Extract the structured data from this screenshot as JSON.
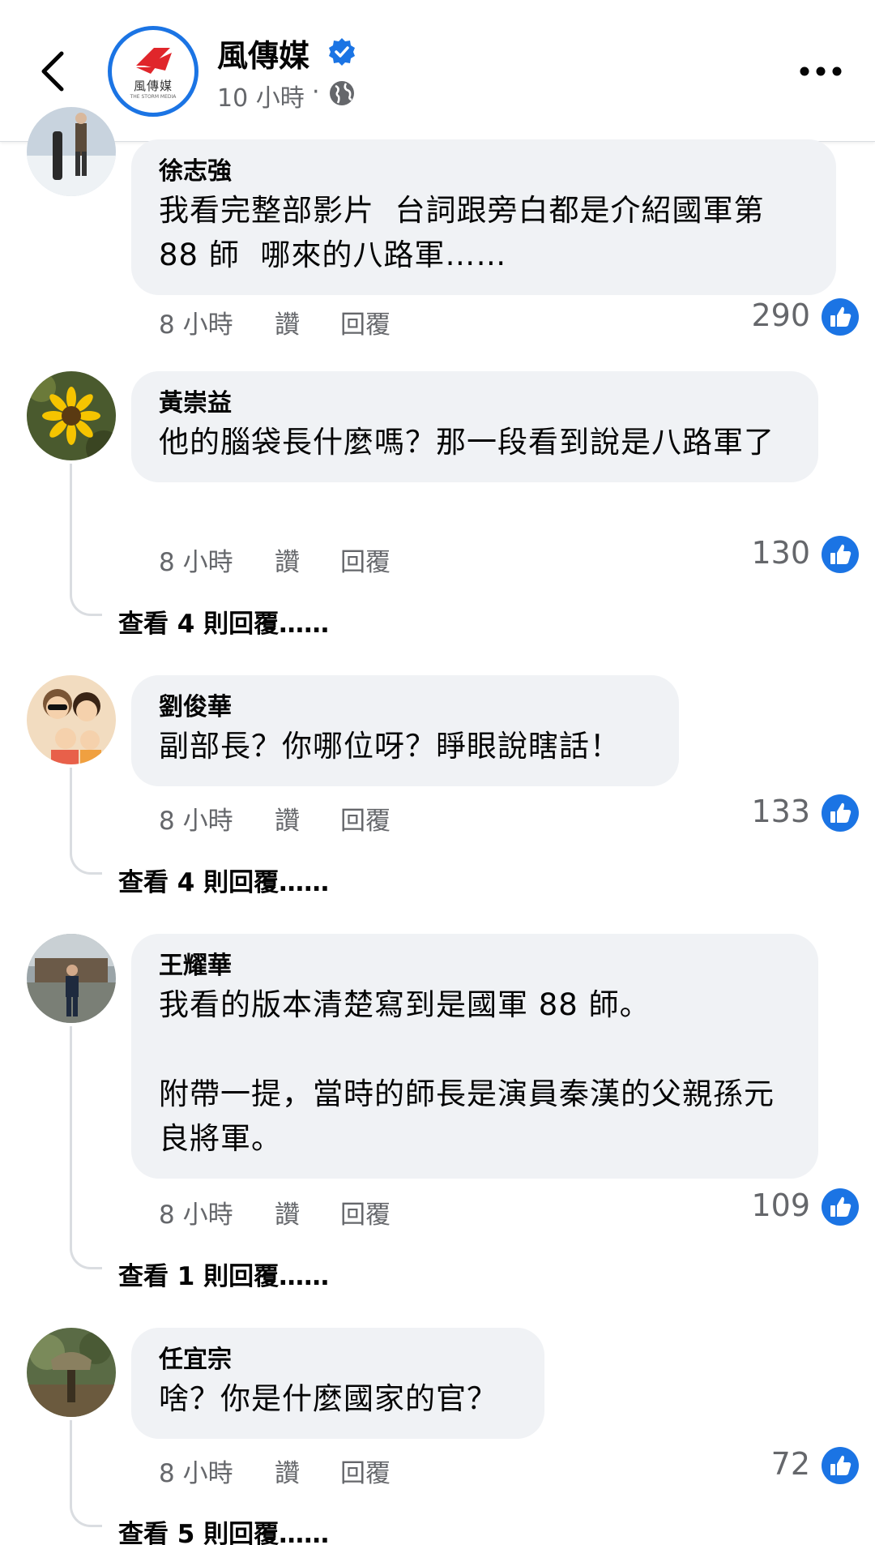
{
  "header": {
    "page_name": "風傳媒",
    "logo_text": "風傳媒",
    "logo_subtext": "THE STORM MEDIA",
    "post_time": "10 小時",
    "separator": "·",
    "icons": {
      "back": "chevron-left-icon",
      "verified": "verified-badge-icon",
      "audience": "globe-icon",
      "more": "more-icon"
    },
    "colors": {
      "accent": "#1b74e4",
      "logo_red": "#e0262b"
    }
  },
  "actions": {
    "like": "讚",
    "reply": "回覆"
  },
  "comments": [
    {
      "author": "徐志強",
      "text": "我看完整部影片  台詞跟旁白都是介紹國軍第 88 師  哪來的八路軍……",
      "time": "8 小時",
      "likes": "290",
      "view_replies": ""
    },
    {
      "author": "黃崇益",
      "text": "他的腦袋長什麼嗎？那一段看到說是八路軍了",
      "time": "8 小時",
      "likes": "130",
      "view_replies": "查看 4 則回覆……"
    },
    {
      "author": "劉俊華",
      "text": "副部長？你哪位呀？睜眼說瞎話！",
      "time": "8 小時",
      "likes": "133",
      "view_replies": "查看 4 則回覆……"
    },
    {
      "author": "王耀華",
      "text": "我看的版本清楚寫到是國軍 88 師。\n\n附帶一提，當時的師長是演員秦漢的父親孫元良將軍。",
      "time": "8 小時",
      "likes": "109",
      "view_replies": "查看 1 則回覆……"
    },
    {
      "author": "任宜宗",
      "text": "啥？你是什麼國家的官？",
      "time": "8 小時",
      "likes": "72",
      "view_replies": "查看 5 則回覆……"
    }
  ]
}
